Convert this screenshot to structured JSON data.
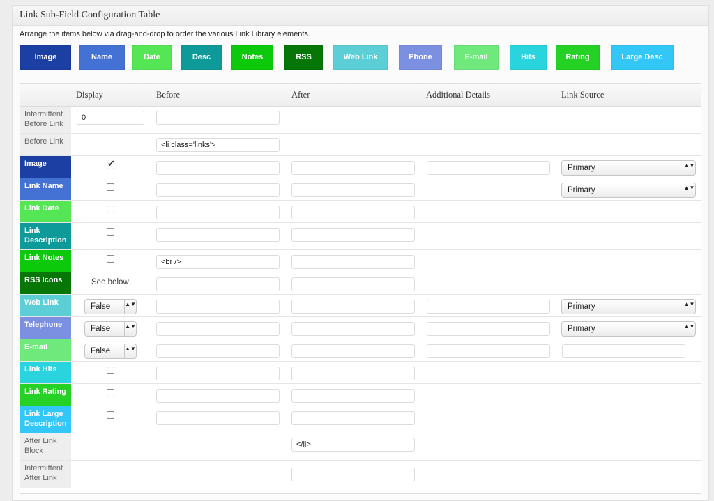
{
  "panel": {
    "title": "Link Sub-Field Configuration Table",
    "instructions": "Arrange the items below via drag-and-drop to order the various Link Library elements."
  },
  "chips": [
    {
      "label": "Image",
      "color": "#1c3fa3"
    },
    {
      "label": "Name",
      "color": "#4472d4"
    },
    {
      "label": "Date",
      "color": "#55e655"
    },
    {
      "label": "Desc",
      "color": "#0f9a9a"
    },
    {
      "label": "Notes",
      "color": "#0cc90c"
    },
    {
      "label": "RSS",
      "color": "#067606"
    },
    {
      "label": "Web Link",
      "color": "#5ccfd6"
    },
    {
      "label": "Phone",
      "color": "#7c90e1"
    },
    {
      "label": "E-mail",
      "color": "#6fe87c"
    },
    {
      "label": "Hits",
      "color": "#29d4de"
    },
    {
      "label": "Rating",
      "color": "#26d126"
    },
    {
      "label": "Large Desc",
      "color": "#33c7f7"
    }
  ],
  "table": {
    "headers": [
      "Display",
      "Before",
      "After",
      "Additional Details",
      "Link Source"
    ],
    "rows": [
      {
        "label": "Intermittent Before Link",
        "display_value": "0",
        "before": "",
        "after": null
      },
      {
        "label": "Before Link",
        "before": "<li class='links'>"
      },
      {
        "label": "Image",
        "checked": true,
        "before": "",
        "after": "",
        "details": "",
        "source": "Primary"
      },
      {
        "label": "Link Name",
        "checked": false,
        "before": "",
        "after": "",
        "source": "Primary"
      },
      {
        "label": "Link Date",
        "checked": false,
        "before": "",
        "after": ""
      },
      {
        "label": "Link Description",
        "checked": false,
        "before": "",
        "after": ""
      },
      {
        "label": "Link Notes",
        "checked": false,
        "before": "<br />",
        "after": ""
      },
      {
        "label": "RSS Icons",
        "display_text": "See below",
        "before": "",
        "after": ""
      },
      {
        "label": "Web Link",
        "display_select": "False",
        "before": "",
        "after": "",
        "details": "",
        "source": "Primary"
      },
      {
        "label": "Telephone",
        "display_select": "False",
        "before": "",
        "after": "",
        "details": "",
        "source": "Primary"
      },
      {
        "label": "E-mail",
        "display_select": "False",
        "before": "",
        "after": "",
        "details": "",
        "source_text": ""
      },
      {
        "label": "Link Hits",
        "checked": false,
        "before": "",
        "after": ""
      },
      {
        "label": "Link Rating",
        "checked": false,
        "before": "",
        "after": ""
      },
      {
        "label": "Link Large Description",
        "checked": false,
        "before": "",
        "after": ""
      },
      {
        "label": "After Link Block",
        "after": "</li>"
      },
      {
        "label": "Intermittent After Link",
        "after": ""
      }
    ]
  },
  "check_mark": "✔",
  "select_arrows": "▲▼"
}
